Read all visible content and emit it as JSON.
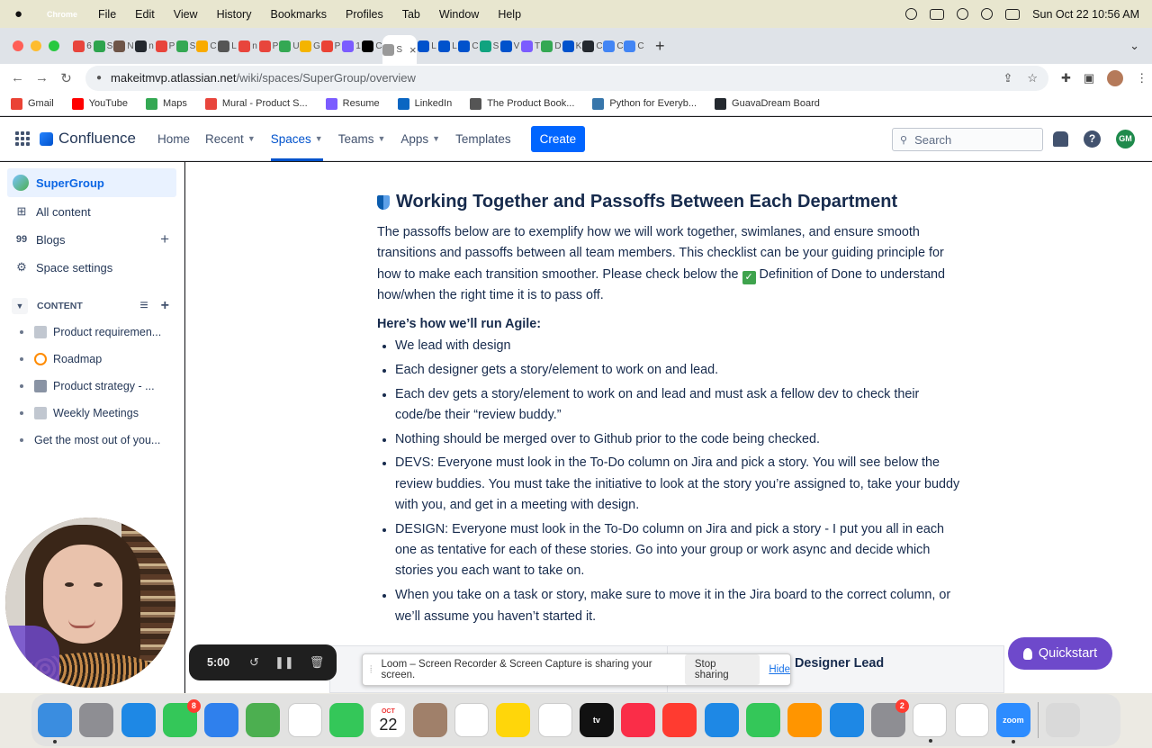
{
  "menubar": {
    "app": "Chrome",
    "items": [
      "File",
      "Edit",
      "View",
      "History",
      "Bookmarks",
      "Profiles",
      "Tab",
      "Window",
      "Help"
    ],
    "datetime": "Sun Oct 22  10:56 AM"
  },
  "tabs": {
    "letters": [
      "6",
      "S",
      "N",
      "n",
      "P",
      "S",
      "C",
      "L",
      "n",
      "P",
      "U",
      "G",
      "P",
      "1",
      "C",
      "S",
      "L",
      "L",
      "C",
      "S",
      "V",
      "T",
      "D",
      "K",
      "C",
      "C",
      "C"
    ],
    "colors": [
      "#e8453c",
      "#2da44e",
      "#6e5548",
      "#24292f",
      "#e8453c",
      "#34a853",
      "#f9ab00",
      "#555",
      "#e8453c",
      "#e8453c",
      "#34a853",
      "#f4b400",
      "#ea4335",
      "#7b5cff",
      "#000",
      "#999",
      "#0052cc",
      "#0052cc",
      "#0052cc",
      "#10a37f",
      "#0052cc",
      "#7b5cff",
      "#34a853",
      "#0052cc",
      "#24292f",
      "#4285f4",
      "#4285f4"
    ]
  },
  "address": {
    "host": "makeitmvp.atlassian.net",
    "path": "/wiki/spaces/SuperGroup/overview"
  },
  "bookmarks": [
    {
      "label": "Gmail",
      "color": "#ea4335"
    },
    {
      "label": "YouTube",
      "color": "#ff0000"
    },
    {
      "label": "Maps",
      "color": "#34a853"
    },
    {
      "label": "Mural - Product S...",
      "color": "#e8453c"
    },
    {
      "label": "Resume",
      "color": "#7b5cff"
    },
    {
      "label": "LinkedIn",
      "color": "#0a66c2"
    },
    {
      "label": "The Product Book...",
      "color": "#555"
    },
    {
      "label": "Python for Everyb...",
      "color": "#3776ab"
    },
    {
      "label": "GuavaDream Board",
      "color": "#24292f"
    }
  ],
  "confluence": {
    "logo": "Confluence",
    "nav": [
      "Home",
      "Recent",
      "Spaces",
      "Teams",
      "Apps",
      "Templates"
    ],
    "create": "Create",
    "search_placeholder": "Search",
    "user_initials": "GM",
    "help": "?"
  },
  "sidebar": {
    "space": "SuperGroup",
    "items": [
      {
        "label": "All content",
        "icon": "⊞"
      },
      {
        "label": "Blogs",
        "icon": "99"
      },
      {
        "label": "Space settings",
        "icon": "⚙"
      }
    ],
    "content_header": "CONTENT",
    "tree": [
      {
        "label": "Product requiremen...",
        "icon_color": "#8993a4"
      },
      {
        "label": "Roadmap",
        "icon_color": "#ff8b00"
      },
      {
        "label": "Product strategy - ...",
        "icon_color": "#5e6c84"
      },
      {
        "label": "Weekly Meetings",
        "icon_color": "#8993a4"
      },
      {
        "label": "Get the most out of you..."
      }
    ]
  },
  "main": {
    "heading": "Working Together and Passoffs Between Each Department",
    "para_before": "The passoffs below are to exemplify how we will work together, swimlanes, and ensure smooth transitions and passoffs between all team members. This checklist can be your guiding principle for how to make each transition smoother. Please check below the ",
    "para_check": "✓",
    "para_after": " Definition of Done to understand how/when the right time it is to pass off.",
    "agile_heading": "Here’s how we’ll run Agile:",
    "bullets": [
      "We lead with design",
      "Each designer gets a story/element to work on and lead.",
      "Each dev gets a story/element to work on and lead and must ask a fellow dev to check their code/be their “review buddy.”",
      "Nothing should be merged over to Github prior to the code being checked.",
      "DEVS: Everyone must look in the To-Do column on Jira and pick a story. You will see below the review buddies. You must take the initiative to look at the story you’re assigned to, take your buddy with you, and get in a meeting with design.",
      "DESIGN: Everyone must look in the To-Do column on Jira and pick a story - I put you all in each one as tentative for each of these stories. Go into your group or work async and decide which stories you each want to take on.",
      "When you take on a task or story, make sure to move it in the Jira board to the correct column, or we’ll assume you haven’t started it."
    ],
    "table_header_right": "Designer Lead"
  },
  "loom": {
    "timer": "5:00",
    "share_text": "Loom – Screen Recorder & Screen Capture is sharing your screen.",
    "stop": "Stop sharing",
    "hide": "Hide"
  },
  "quickstart": "Quickstart",
  "dock": {
    "apps": [
      {
        "name": "finder",
        "color": "#3a8de0",
        "label": ""
      },
      {
        "name": "launchpad",
        "color": "#8e8e93",
        "label": ""
      },
      {
        "name": "safari",
        "color": "#1e88e5",
        "label": ""
      },
      {
        "name": "messages",
        "color": "#34c759",
        "label": "",
        "badge": "8"
      },
      {
        "name": "mail",
        "color": "#2f80ed",
        "label": ""
      },
      {
        "name": "maps",
        "color": "#4caf50",
        "label": ""
      },
      {
        "name": "photos",
        "color": "#ffffff",
        "label": ""
      },
      {
        "name": "facetime",
        "color": "#34c759",
        "label": ""
      },
      {
        "name": "calendar",
        "month": "OCT",
        "day": "22"
      },
      {
        "name": "contacts",
        "color": "#a0806a",
        "label": ""
      },
      {
        "name": "reminders",
        "color": "#ffffff",
        "label": ""
      },
      {
        "name": "notes",
        "color": "#ffd60a",
        "label": ""
      },
      {
        "name": "freeform",
        "color": "#ffffff",
        "label": ""
      },
      {
        "name": "tv",
        "color": "#111111",
        "label": "tv"
      },
      {
        "name": "music",
        "color": "#fa2d48",
        "label": ""
      },
      {
        "name": "news",
        "color": "#ff3b30",
        "label": ""
      },
      {
        "name": "keynote",
        "color": "#1e88e5",
        "label": ""
      },
      {
        "name": "numbers",
        "color": "#34c759",
        "label": ""
      },
      {
        "name": "pages",
        "color": "#ff9500",
        "label": ""
      },
      {
        "name": "app-store",
        "color": "#1e88e5",
        "label": ""
      },
      {
        "name": "system-settings",
        "color": "#8e8e93",
        "label": "",
        "badge": "2"
      },
      {
        "name": "chrome",
        "color": "#ffffff",
        "label": ""
      },
      {
        "name": "slack",
        "color": "#ffffff",
        "label": ""
      },
      {
        "name": "zoom",
        "color": "#2d8cff",
        "label": "zoom"
      },
      {
        "name": "trash",
        "color": "#d9d9d9",
        "label": ""
      }
    ]
  }
}
